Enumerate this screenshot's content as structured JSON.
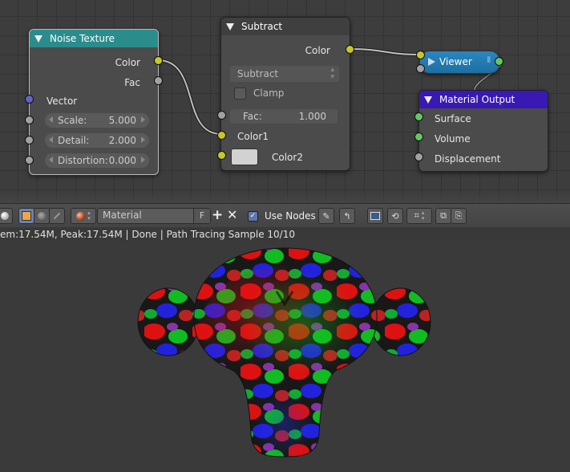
{
  "nodes": {
    "noise_texture": {
      "title": "Noise Texture",
      "header_color": "#2b8c8c",
      "outputs": [
        "Color",
        "Fac"
      ],
      "input_vector": "Vector",
      "fields": [
        {
          "label": "Scale:",
          "value": "5.000"
        },
        {
          "label": "Detail:",
          "value": "2.000"
        },
        {
          "label": "Distortion:",
          "value": "0.000"
        }
      ]
    },
    "subtract": {
      "title": "Subtract",
      "header_color": "#3f3f3f",
      "output": "Color",
      "mode": "Subtract",
      "clamp_label": "Clamp",
      "fac_label": "Fac:",
      "fac_value": "1.000",
      "inputs": [
        "Color1",
        "Color2"
      ]
    },
    "viewer": {
      "title": "Viewer",
      "header_color": "#1e6fa0"
    },
    "material_output": {
      "title": "Material Output",
      "header_color": "#3a18b3",
      "inputs": [
        "Surface",
        "Volume",
        "Displacement"
      ]
    }
  },
  "toolbar": {
    "material_name": "Material",
    "fake_user": "F",
    "add_icon": "plus-icon",
    "close_icon": "x-icon",
    "use_nodes_label": "Use Nodes",
    "use_nodes_checked": true
  },
  "status": {
    "text": "em:17.54M, Peak:17.54M | Done | Path Tracing Sample 10/10"
  },
  "colors": {
    "socket_color": "#c7c729",
    "socket_shader": "#63c763",
    "socket_vector": "#6363c7",
    "socket_value": "#a1a1a1",
    "accent_blue": "#5e77ac"
  }
}
